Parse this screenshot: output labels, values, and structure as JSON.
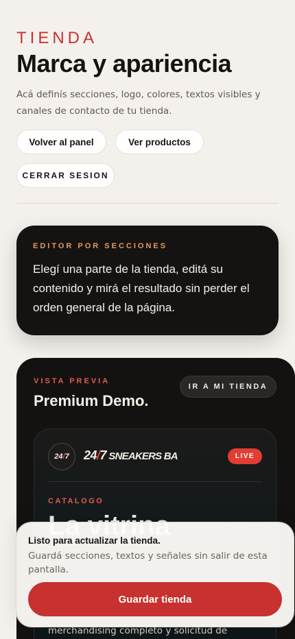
{
  "header": {
    "eyebrow": "TIENDA",
    "title": "Marca y apariencia",
    "description": "Acá definís secciones, logo, colores, textos visibles y canales de contacto de tu tienda."
  },
  "actions": {
    "back_label": "Volver al panel",
    "products_label": "Ver productos",
    "logout_label": "CERRAR SESION"
  },
  "editor": {
    "eyebrow": "EDITOR POR SECCIONES",
    "text": "Elegí una parte de la tienda, editá su contenido y mirá el resultado sin perder el orden general de la página."
  },
  "preview": {
    "eyebrow": "VISTA PREVIA",
    "title": "Premium Demo.",
    "store_button_label": "IR A MI TIENDA",
    "store": {
      "badge_left": "24",
      "badge_slash": "/",
      "badge_right": "7",
      "logo_num": "24",
      "logo_slash": "/",
      "logo_num2": "7",
      "logo_rest": " SNEAKERS BA",
      "live_label": "LIVE",
      "catalog_eyebrow": "CATALOGO",
      "hero_text": "La vitrina",
      "hero_desc": "merchandising completo y solicitud de"
    }
  },
  "save": {
    "title": "Listo para actualizar la tienda.",
    "description": "Guardá secciones, textos y señales sin salir de esta pantalla.",
    "button_label": "Guardar tienda"
  },
  "colors": {
    "accent": "#c7312f",
    "background": "#f4f1ec",
    "dark_card": "#151312"
  }
}
